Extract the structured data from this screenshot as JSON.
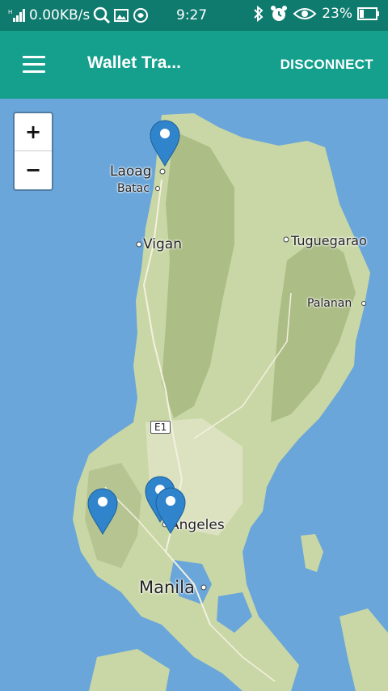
{
  "status": {
    "net_speed": "0.00KB/s",
    "time": "9:27",
    "battery": "23%"
  },
  "appbar": {
    "title": "Wallet Tra...",
    "action": "DISCONNECT"
  },
  "map": {
    "zoom_in": "+",
    "zoom_out": "−",
    "places": {
      "laoag": "Laoag",
      "batac": "Batac",
      "vigan": "Vigan",
      "tuguegarao": "Tuguegarao",
      "palanan": "Palanan",
      "angeles": "Angeles",
      "manila": "Manila",
      "e1": "E1"
    },
    "marker_count": 4
  },
  "colors": {
    "statusbar": "#0f7a6e",
    "appbar": "#159f8d",
    "water": "#6aa6d9",
    "marker": "#2f84cb"
  }
}
